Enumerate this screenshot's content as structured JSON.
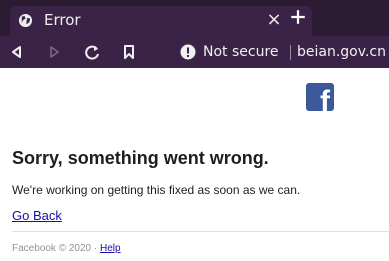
{
  "browser": {
    "tab_title": "Error",
    "tab_favicon": "world-icon",
    "close_glyph": "×",
    "security_label": "Not secure",
    "url": "beian.gov.cn",
    "colors": {
      "tabbar": "#2b1b33",
      "toolbar": "#3b2347",
      "chrome_text": "#f0f0f0"
    }
  },
  "page": {
    "logo": "facebook-logo",
    "heading": "Sorry, something went wrong.",
    "message": "We're working on getting this fixed as soon as we can.",
    "go_back": "Go Back",
    "footer_text": "Facebook © 2020 · ",
    "help_link": "Help",
    "colors": {
      "brand": "#3b5998",
      "link": "#1a0dab",
      "text": "#1c1e21",
      "footer": "#90949c"
    }
  }
}
